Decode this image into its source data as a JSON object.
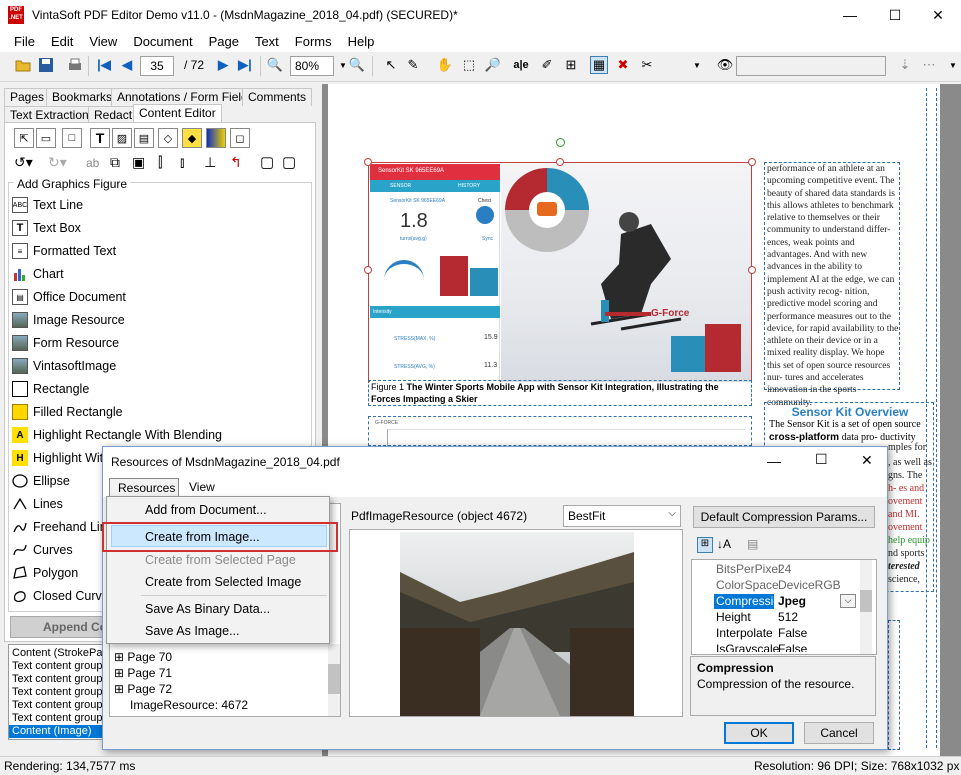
{
  "window": {
    "title": "VintaSoft PDF Editor Demo v11.0 -  (MsdnMagazine_2018_04.pdf) (SECURED)*",
    "app_icon_text": "PDF .NET",
    "min": "—",
    "max": "☐",
    "close": "✕"
  },
  "menu": [
    "File",
    "Edit",
    "View",
    "Document",
    "Page",
    "Text",
    "Forms",
    "Help"
  ],
  "toolbar": {
    "page_current": "35",
    "page_total": "/ 72",
    "zoom": "80%",
    "search_placeholder": ""
  },
  "left_tabs_row1": [
    "Pages",
    "Bookmarks",
    "Annotations / Form Fields",
    "Comments"
  ],
  "left_tabs_row2": [
    "Text Extraction",
    "Redact",
    "Content Editor"
  ],
  "add_graphics": {
    "title": "Add Graphics Figure",
    "items": [
      {
        "label": "Text Line",
        "icon": "abc-icon"
      },
      {
        "label": "Text Box",
        "icon": "textbox-icon"
      },
      {
        "label": "Formatted Text",
        "icon": "formatted-text-icon"
      },
      {
        "label": "Chart",
        "icon": "chart-icon"
      },
      {
        "label": "Office Document",
        "icon": "office-document-icon"
      },
      {
        "label": "Image Resource",
        "icon": "image-icon"
      },
      {
        "label": "Form Resource",
        "icon": "form-icon"
      },
      {
        "label": "VintasoftImage",
        "icon": "image-icon"
      },
      {
        "label": "Rectangle",
        "icon": "rectangle-icon"
      },
      {
        "label": "Filled Rectangle",
        "icon": "filled-rectangle-icon"
      },
      {
        "label": "Highlight Rectangle With Blending",
        "icon": "highlight-icon"
      },
      {
        "label": "Highlight Wit",
        "icon": "highlight-icon"
      },
      {
        "label": "Ellipse",
        "icon": "ellipse-icon"
      },
      {
        "label": "Lines",
        "icon": "lines-icon"
      },
      {
        "label": "Freehand Line",
        "icon": "freehand-icon"
      },
      {
        "label": "Curves",
        "icon": "curves-icon"
      },
      {
        "label": "Polygon",
        "icon": "polygon-icon"
      },
      {
        "label": "Closed Curve",
        "icon": "closed-curve-icon"
      }
    ],
    "append_button": "Append Co"
  },
  "content_list": [
    "Content (StrokePat",
    "Text content group",
    "Text content group",
    "Text content group",
    "Text content group",
    "Text content group",
    "Content (Image)"
  ],
  "document": {
    "figure_caption_prefix": "Figure 1",
    "figure_caption": "The Winter Sports Mobile App with Sensor Kit Integration, Illustrating the Forces Impacting a Skier",
    "column_text": "performance of an athlete at an upcoming competitive event. The beauty of shared data standards is this allows athletes to benchmark relative to themselves or their community to understand differ- ences, weak points and advantages. And with new advances in the ability to implement AI at the edge, we can push activity recog- nition, predictive model scoring and performance measures out to the device, for rapid availability to the athlete on their device or in a mixed reality display. We hope this set of open source resources nur- tures and accelerates innovation in the sports community.",
    "sidebar_heading": "Sensor Kit Overview",
    "sidebar_text_1": "The Sensor Kit is a set of open source",
    "sidebar_bold": "cross-platform",
    "sidebar_text_2": "data pro- ductivity",
    "sidebar_fragments": [
      "mples for",
      ", as well as",
      "gns. The",
      "h- es and",
      "ovement",
      "and MI.",
      "ovement",
      "help equip",
      "nd sports",
      "terested",
      "science,"
    ],
    "app": {
      "header": "SensorKit SK 965EE69A",
      "tab1": "SENSOR",
      "tab2": "HISTORY",
      "device": "SensorKit SK 965EE69A",
      "value": "1.8",
      "unit": "turns(avg,g)",
      "label_chest": "Chest",
      "label_sync": "Sync",
      "intensity": "Intensity",
      "stress_max": "STRESS(MAX, %)",
      "stress_max_val": "15.9",
      "stress_avg": "STRESS(AVG, %)",
      "stress_avg_val": "11.3",
      "gforce": "G-Force"
    },
    "gforce_chart_label": "G-FORCE"
  },
  "dialog": {
    "title": "Resources of MsdnMagazine_2018_04.pdf",
    "menu": [
      "Resources",
      "View"
    ],
    "resource_label": "PdfImageResource (object 4672)",
    "fit_mode": "BestFit",
    "compression_button": "Default Compression Params...",
    "tree": [
      "Page 70",
      "Page 71",
      "Page 72",
      "ImageResource: 4672"
    ],
    "properties": [
      {
        "name": "BitsPerPixel",
        "value": "24"
      },
      {
        "name": "ColorSpace",
        "value": "DeviceRGB"
      },
      {
        "name": "Compression",
        "value": "Jpeg"
      },
      {
        "name": "Height",
        "value": "512"
      },
      {
        "name": "Interpolate",
        "value": "False"
      },
      {
        "name": "IsGrayscale",
        "value": "False"
      }
    ],
    "description_title": "Compression",
    "description_text": "Compression of the resource.",
    "ok": "OK",
    "cancel": "Cancel"
  },
  "dropdown": {
    "items": [
      {
        "label": "Add from Document...",
        "enabled": true
      },
      {
        "label": "Create from Image...",
        "enabled": true,
        "highlighted": true
      },
      {
        "label": "Create from Selected Page",
        "enabled": false
      },
      {
        "label": "Create from Selected Image",
        "enabled": true
      },
      {
        "label": "Save As Binary Data...",
        "enabled": true
      },
      {
        "label": "Save As Image...",
        "enabled": true
      }
    ]
  },
  "status": {
    "left": "Rendering: 134,7577 ms",
    "right": "Resolution: 96 DPI; Size: 768x1032 px"
  },
  "colors": {
    "accent_blue": "#0078d7",
    "highlight_red": "#d03030",
    "selection_blue": "#0078d7",
    "heading_blue": "#2a7fc4"
  }
}
